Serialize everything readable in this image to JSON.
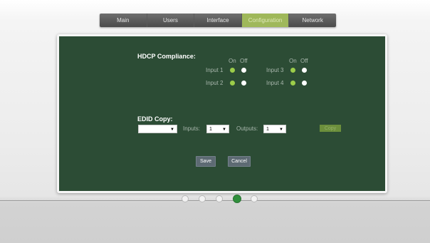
{
  "nav": {
    "tabs": [
      "Main",
      "Users",
      "Interface",
      "Configuration",
      "Network"
    ],
    "active": "Configuration"
  },
  "hdcp": {
    "title": "HDCP Compliance:",
    "on_label": "On",
    "off_label": "Off",
    "inputs": [
      {
        "label": "Input 1",
        "state": "on"
      },
      {
        "label": "Input 2",
        "state": "on"
      },
      {
        "label": "Input 3",
        "state": "on"
      },
      {
        "label": "Input 4",
        "state": "on"
      }
    ]
  },
  "edid": {
    "title": "EDID Copy:",
    "source_value": "",
    "inputs_label": "Inputs:",
    "inputs_value": "1",
    "outputs_label": "Outputs:",
    "outputs_value": "1",
    "copy_label": "Copy"
  },
  "actions": {
    "save_label": "Save",
    "cancel_label": "Cancel"
  },
  "pager": {
    "count": 5,
    "active_index": 3
  },
  "colors": {
    "panel": "#2c4c35",
    "accent": "#9fb85a",
    "radio_on": "#9ccd4a",
    "pager_active": "#2f8f3c"
  }
}
